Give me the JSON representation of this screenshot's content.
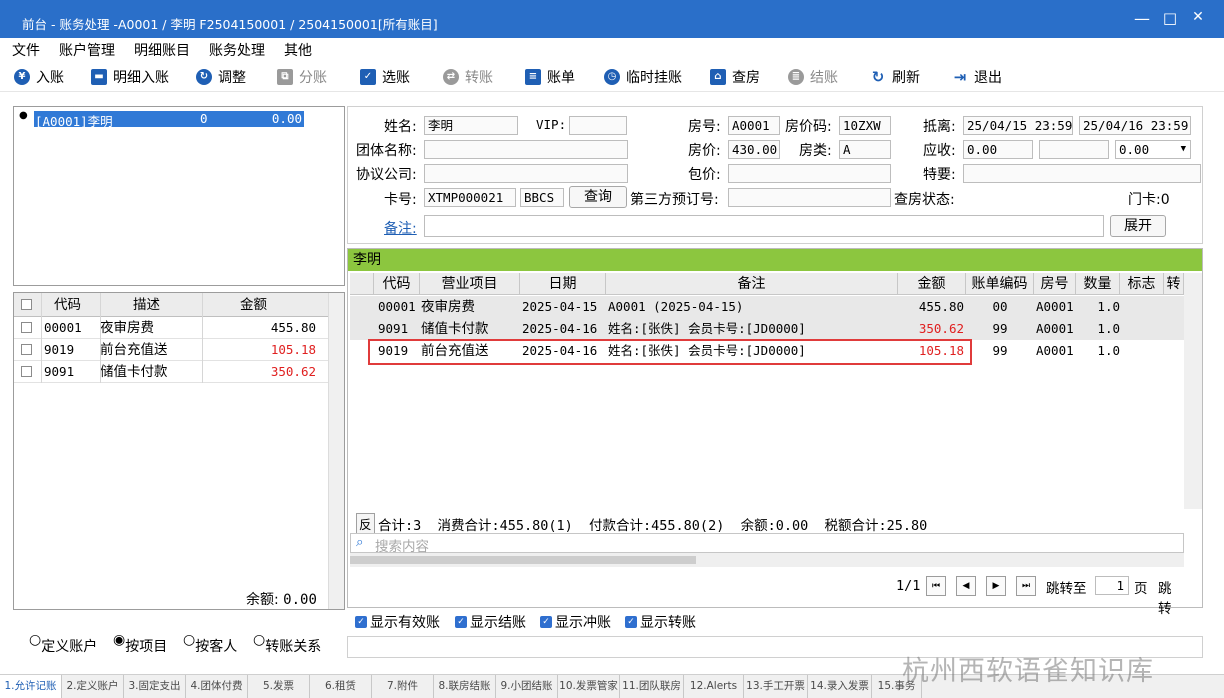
{
  "window": {
    "title": "前台 - 账务处理 -A0001 / 李明  F2504150001 / 2504150001[所有账目]",
    "min": "—",
    "max": "□",
    "close": "✕"
  },
  "menu": [
    "文件",
    "账户管理",
    "明细账目",
    "账务处理",
    "其他"
  ],
  "toolbar": [
    {
      "label": "入账",
      "icon": "yen-icon",
      "enabled": true
    },
    {
      "label": "明细入账",
      "icon": "keyboard-icon",
      "enabled": true
    },
    {
      "label": "调整",
      "icon": "adjust-icon",
      "enabled": true
    },
    {
      "label": "分账",
      "icon": "split-icon",
      "enabled": false
    },
    {
      "label": "选账",
      "icon": "select-icon",
      "enabled": true
    },
    {
      "label": "转账",
      "icon": "transfer-icon",
      "enabled": false
    },
    {
      "label": "账单",
      "icon": "bill-icon",
      "enabled": true
    },
    {
      "label": "临时挂账",
      "icon": "clock-icon",
      "enabled": true
    },
    {
      "label": "查房",
      "icon": "house-icon",
      "enabled": true
    },
    {
      "label": "结账",
      "icon": "coins-icon",
      "enabled": false
    },
    {
      "label": "刷新",
      "icon": "refresh-icon",
      "enabled": true
    },
    {
      "label": "退出",
      "icon": "exit-icon",
      "enabled": true
    }
  ],
  "accounts": {
    "selected": "[A0001]李明",
    "count": "0",
    "amount": "0.00"
  },
  "left_grid": {
    "headers": [
      "代码",
      "描述",
      "金额"
    ],
    "rows": [
      {
        "code": "00001",
        "desc": "夜审房费",
        "amount": "455.80",
        "red": false
      },
      {
        "code": "9019",
        "desc": "前台充值送",
        "amount": "105.18",
        "red": true
      },
      {
        "code": "9091",
        "desc": "储值卡付款",
        "amount": "350.62",
        "red": true
      }
    ],
    "balance_label": "余额:",
    "balance": "0.00"
  },
  "radio": {
    "options": [
      "定义账户",
      "按项目",
      "按客人",
      "转账关系"
    ],
    "selected": "按项目"
  },
  "info": {
    "name_label": "姓名:",
    "name": "李明",
    "vip_label": "VIP:",
    "vip": "",
    "room_label": "房号:",
    "room": "A0001",
    "room_price_code_label": "房价码:",
    "room_price_code": "10ZXW",
    "arrival_label": "抵离:",
    "arrival": "25/04/15 23:59",
    "departure": "25/04/16 23:59",
    "group_label": "团体名称:",
    "group": "",
    "price_label": "房价:",
    "price": "430.00",
    "room_type_label": "房类:",
    "room_type": "A",
    "receivable_label": "应收:",
    "receivable": "0.00",
    "receivable2": "",
    "receivable3": "0.00",
    "company_label": "协议公司:",
    "company": "",
    "package_label": "包价:",
    "package": "",
    "special_label": "特要:",
    "special": "",
    "card_label": "卡号:",
    "card": "XTMP000021",
    "card_type": "BBCS",
    "query_btn": "查询",
    "third_label": "第三方预订号:",
    "third": "",
    "checkroom_label": "查房状态:",
    "checkroom": "",
    "door_label": "门卡:",
    "door": "0",
    "remark_label": "备注:",
    "remark": "",
    "expand_btn": "展开"
  },
  "bill": {
    "title": "李明",
    "headers": [
      "代码",
      "营业项目",
      "日期",
      "备注",
      "金额",
      "账单编码",
      "房号",
      "数量",
      "标志",
      "转"
    ],
    "rows": [
      {
        "code": "00001",
        "item": "夜审房费",
        "date": "2025-04-15",
        "note": "A0001 (2025-04-15)",
        "amount": "455.80",
        "bill_no": "00",
        "room": "A0001",
        "qty": "1.0",
        "flag": "",
        "tr": "",
        "red": false
      },
      {
        "code": "9091",
        "item": "储值卡付款",
        "date": "2025-04-16",
        "note": "姓名:[张佚] 会员卡号:[JD0000]",
        "amount": "350.62",
        "bill_no": "99",
        "room": "A0001",
        "qty": "1.0",
        "flag": "",
        "tr": "",
        "red": true
      },
      {
        "code": "9019",
        "item": "前台充值送",
        "date": "2025-04-16",
        "note": "姓名:[张佚] 会员卡号:[JD0000]",
        "amount": "105.18",
        "bill_no": "99",
        "room": "A0001",
        "qty": "1.0",
        "flag": "",
        "tr": "",
        "red": true
      }
    ],
    "fan": "反",
    "summary": "合计:3  消费合计:455.80(1)  付款合计:455.80(2)  余额:0.00  税额合计:25.80",
    "search_placeholder": "搜索内容",
    "page": "1/1",
    "goto_label": "跳转至",
    "goto_value": "1",
    "page_unit": "页",
    "goto_btn": "跳转"
  },
  "checks": [
    "显示有效账",
    "显示结账",
    "显示冲账",
    "显示转账"
  ],
  "tabs": [
    "1.允许记账",
    "2.定义账户",
    "3.固定支出",
    "4.团体付费",
    "5.发票",
    "6.租赁",
    "7.附件",
    "8.联房结账",
    "9.小团结账",
    "10.发票管家",
    "11.团队联房",
    "12.Alerts",
    "13.手工开票",
    "14.录入发票",
    "15.事务"
  ],
  "watermark": "杭州西软语雀知识库"
}
